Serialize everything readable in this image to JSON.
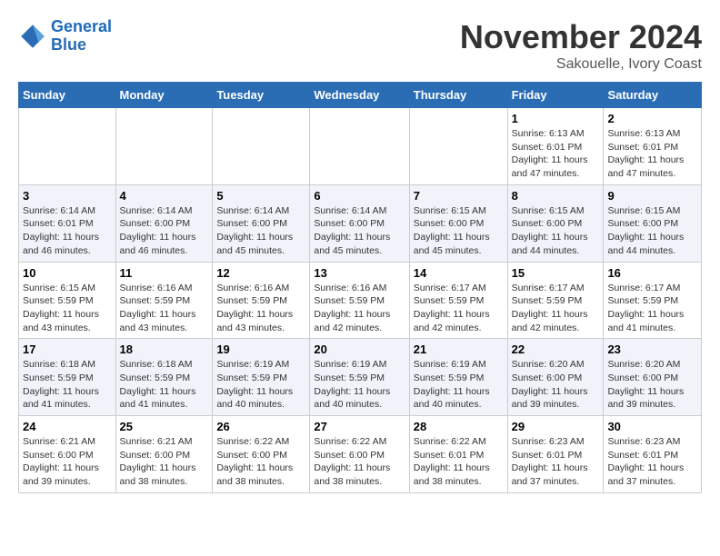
{
  "logo": {
    "line1": "General",
    "line2": "Blue"
  },
  "title": "November 2024",
  "location": "Sakouelle, Ivory Coast",
  "weekdays": [
    "Sunday",
    "Monday",
    "Tuesday",
    "Wednesday",
    "Thursday",
    "Friday",
    "Saturday"
  ],
  "weeks": [
    [
      {
        "day": "",
        "info": ""
      },
      {
        "day": "",
        "info": ""
      },
      {
        "day": "",
        "info": ""
      },
      {
        "day": "",
        "info": ""
      },
      {
        "day": "",
        "info": ""
      },
      {
        "day": "1",
        "info": "Sunrise: 6:13 AM\nSunset: 6:01 PM\nDaylight: 11 hours and 47 minutes."
      },
      {
        "day": "2",
        "info": "Sunrise: 6:13 AM\nSunset: 6:01 PM\nDaylight: 11 hours and 47 minutes."
      }
    ],
    [
      {
        "day": "3",
        "info": "Sunrise: 6:14 AM\nSunset: 6:01 PM\nDaylight: 11 hours and 46 minutes."
      },
      {
        "day": "4",
        "info": "Sunrise: 6:14 AM\nSunset: 6:00 PM\nDaylight: 11 hours and 46 minutes."
      },
      {
        "day": "5",
        "info": "Sunrise: 6:14 AM\nSunset: 6:00 PM\nDaylight: 11 hours and 45 minutes."
      },
      {
        "day": "6",
        "info": "Sunrise: 6:14 AM\nSunset: 6:00 PM\nDaylight: 11 hours and 45 minutes."
      },
      {
        "day": "7",
        "info": "Sunrise: 6:15 AM\nSunset: 6:00 PM\nDaylight: 11 hours and 45 minutes."
      },
      {
        "day": "8",
        "info": "Sunrise: 6:15 AM\nSunset: 6:00 PM\nDaylight: 11 hours and 44 minutes."
      },
      {
        "day": "9",
        "info": "Sunrise: 6:15 AM\nSunset: 6:00 PM\nDaylight: 11 hours and 44 minutes."
      }
    ],
    [
      {
        "day": "10",
        "info": "Sunrise: 6:15 AM\nSunset: 5:59 PM\nDaylight: 11 hours and 43 minutes."
      },
      {
        "day": "11",
        "info": "Sunrise: 6:16 AM\nSunset: 5:59 PM\nDaylight: 11 hours and 43 minutes."
      },
      {
        "day": "12",
        "info": "Sunrise: 6:16 AM\nSunset: 5:59 PM\nDaylight: 11 hours and 43 minutes."
      },
      {
        "day": "13",
        "info": "Sunrise: 6:16 AM\nSunset: 5:59 PM\nDaylight: 11 hours and 42 minutes."
      },
      {
        "day": "14",
        "info": "Sunrise: 6:17 AM\nSunset: 5:59 PM\nDaylight: 11 hours and 42 minutes."
      },
      {
        "day": "15",
        "info": "Sunrise: 6:17 AM\nSunset: 5:59 PM\nDaylight: 11 hours and 42 minutes."
      },
      {
        "day": "16",
        "info": "Sunrise: 6:17 AM\nSunset: 5:59 PM\nDaylight: 11 hours and 41 minutes."
      }
    ],
    [
      {
        "day": "17",
        "info": "Sunrise: 6:18 AM\nSunset: 5:59 PM\nDaylight: 11 hours and 41 minutes."
      },
      {
        "day": "18",
        "info": "Sunrise: 6:18 AM\nSunset: 5:59 PM\nDaylight: 11 hours and 41 minutes."
      },
      {
        "day": "19",
        "info": "Sunrise: 6:19 AM\nSunset: 5:59 PM\nDaylight: 11 hours and 40 minutes."
      },
      {
        "day": "20",
        "info": "Sunrise: 6:19 AM\nSunset: 5:59 PM\nDaylight: 11 hours and 40 minutes."
      },
      {
        "day": "21",
        "info": "Sunrise: 6:19 AM\nSunset: 5:59 PM\nDaylight: 11 hours and 40 minutes."
      },
      {
        "day": "22",
        "info": "Sunrise: 6:20 AM\nSunset: 6:00 PM\nDaylight: 11 hours and 39 minutes."
      },
      {
        "day": "23",
        "info": "Sunrise: 6:20 AM\nSunset: 6:00 PM\nDaylight: 11 hours and 39 minutes."
      }
    ],
    [
      {
        "day": "24",
        "info": "Sunrise: 6:21 AM\nSunset: 6:00 PM\nDaylight: 11 hours and 39 minutes."
      },
      {
        "day": "25",
        "info": "Sunrise: 6:21 AM\nSunset: 6:00 PM\nDaylight: 11 hours and 38 minutes."
      },
      {
        "day": "26",
        "info": "Sunrise: 6:22 AM\nSunset: 6:00 PM\nDaylight: 11 hours and 38 minutes."
      },
      {
        "day": "27",
        "info": "Sunrise: 6:22 AM\nSunset: 6:00 PM\nDaylight: 11 hours and 38 minutes."
      },
      {
        "day": "28",
        "info": "Sunrise: 6:22 AM\nSunset: 6:01 PM\nDaylight: 11 hours and 38 minutes."
      },
      {
        "day": "29",
        "info": "Sunrise: 6:23 AM\nSunset: 6:01 PM\nDaylight: 11 hours and 37 minutes."
      },
      {
        "day": "30",
        "info": "Sunrise: 6:23 AM\nSunset: 6:01 PM\nDaylight: 11 hours and 37 minutes."
      }
    ]
  ]
}
